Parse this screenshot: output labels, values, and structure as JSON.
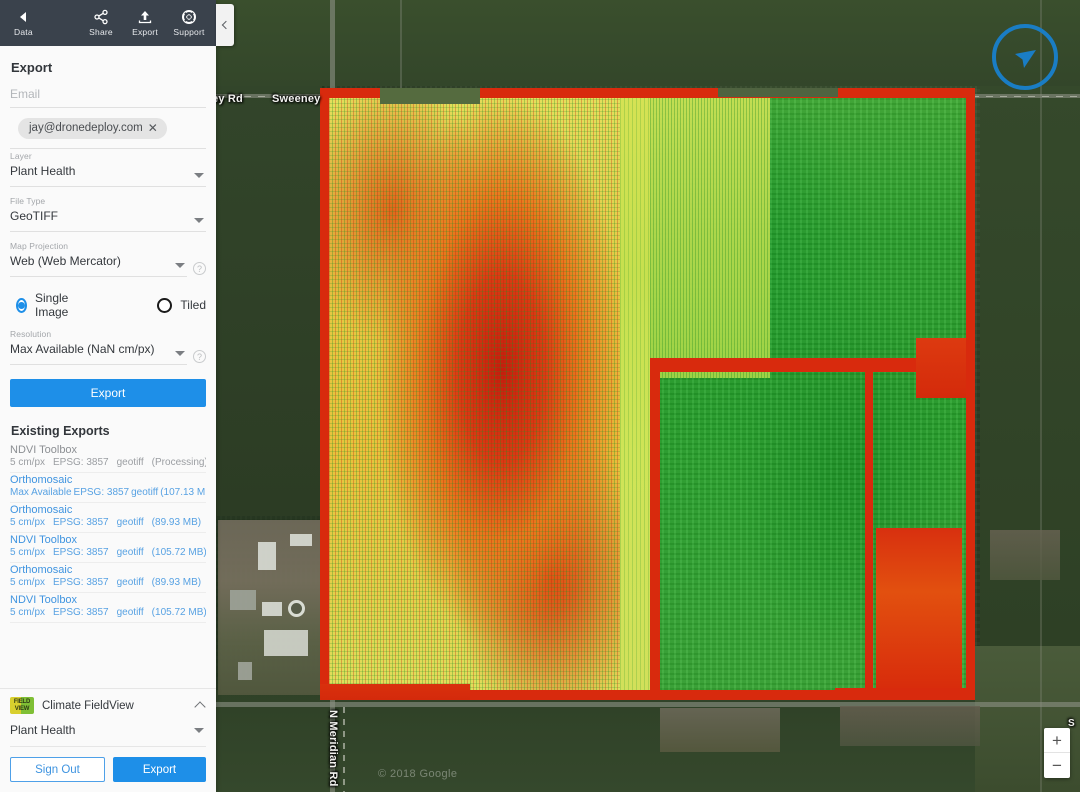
{
  "topbar": {
    "data_label": "Data",
    "back_icon": "back-arrow-icon",
    "share_label": "Share",
    "export_label": "Export",
    "support_label": "Support"
  },
  "collapse": {
    "icon": "chevron-left-icon"
  },
  "export_panel": {
    "title": "Export",
    "email_placeholder": "Email",
    "email_chip": "jay@dronedeploy.com",
    "chip_remove": "✕",
    "layer": {
      "label": "Layer",
      "value": "Plant Health"
    },
    "file_type": {
      "label": "File Type",
      "value": "GeoTIFF"
    },
    "map_projection": {
      "label": "Map Projection",
      "value": "Web (Web Mercator)",
      "help": "?"
    },
    "image_mode": {
      "single_label": "Single Image",
      "tiled_label": "Tiled",
      "selected": "Single Image"
    },
    "resolution": {
      "label": "Resolution",
      "value": "Max Available (NaN cm/px)",
      "help": "?"
    },
    "export_button": "Export"
  },
  "existing_exports": {
    "title": "Existing Exports",
    "items": [
      {
        "name": "NDVI Toolbox",
        "resolution": "5 cm/px",
        "epsg": "EPSG: 3857",
        "format": "geotiff",
        "size": "(Processing)",
        "link": false
      },
      {
        "name": "Orthomosaic",
        "resolution": "Max Available",
        "epsg": "EPSG: 3857",
        "format": "geotiff",
        "size": "(107.13 MB)",
        "link": true
      },
      {
        "name": "Orthomosaic",
        "resolution": "5 cm/px",
        "epsg": "EPSG: 3857",
        "format": "geotiff",
        "size": "(89.93 MB)",
        "link": true
      },
      {
        "name": "NDVI Toolbox",
        "resolution": "5 cm/px",
        "epsg": "EPSG: 3857",
        "format": "geotiff",
        "size": "(105.72 MB)",
        "link": true
      },
      {
        "name": "Orthomosaic",
        "resolution": "5 cm/px",
        "epsg": "EPSG: 3857",
        "format": "geotiff",
        "size": "(89.93 MB)",
        "link": true
      },
      {
        "name": "NDVI Toolbox",
        "resolution": "5 cm/px",
        "epsg": "EPSG: 3857",
        "format": "geotiff",
        "size": "(105.72 MB)",
        "link": true
      }
    ]
  },
  "fieldview": {
    "title": "Climate FieldView",
    "logo_line1": "FIELD",
    "logo_line2": "VIEW",
    "collapse_icon": "chevron-up-icon",
    "layer_value": "Plant Health",
    "sign_out_label": "Sign Out",
    "export_label": "Export"
  },
  "map": {
    "labels": {
      "sweeney_a": "ey Rd",
      "sweeney_b": "Sweeney",
      "meridian": "N Meridian Rd",
      "edge": "S"
    },
    "attribution": "© 2018 Google",
    "logo_name": "dronedeploy-logo",
    "zoom_in": "+",
    "zoom_out": "−"
  },
  "colors": {
    "accent": "#1e8fe8",
    "topbar_bg": "#3a424c",
    "panel_bg": "#fafafa",
    "link": "#3f94e0",
    "ndvi_red": "#d82a0d",
    "ndvi_yellow": "#e6c842",
    "ndvi_green": "#27a12b"
  }
}
